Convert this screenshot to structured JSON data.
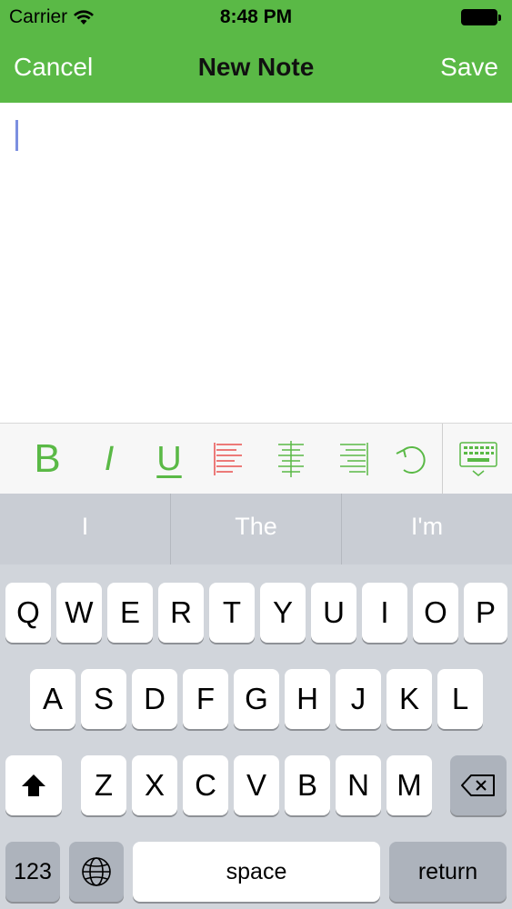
{
  "status": {
    "carrier": "Carrier",
    "time": "8:48 PM",
    "wifi_icon": "wifi-icon",
    "battery_icon": "battery-icon"
  },
  "nav": {
    "cancel": "Cancel",
    "title": "New Note",
    "save": "Save"
  },
  "editor": {
    "text": ""
  },
  "toolbar": {
    "bold": "B",
    "italic": "I",
    "underline": "U",
    "icons": [
      "align-left-icon",
      "align-center-icon",
      "align-right-icon",
      "undo-icon",
      "keyboard-dismiss-icon"
    ]
  },
  "suggestions": [
    "I",
    "The",
    "I'm"
  ],
  "keyboard": {
    "row1": [
      "Q",
      "W",
      "E",
      "R",
      "T",
      "Y",
      "U",
      "I",
      "O",
      "P"
    ],
    "row2": [
      "A",
      "S",
      "D",
      "F",
      "G",
      "H",
      "J",
      "K",
      "L"
    ],
    "row3": [
      "Z",
      "X",
      "C",
      "V",
      "B",
      "N",
      "M"
    ],
    "numbers": "123",
    "space": "space",
    "return": "return"
  },
  "colors": {
    "accent": "#5ab946",
    "align_left": "#e8504f",
    "caret": "#7c8fe0"
  }
}
